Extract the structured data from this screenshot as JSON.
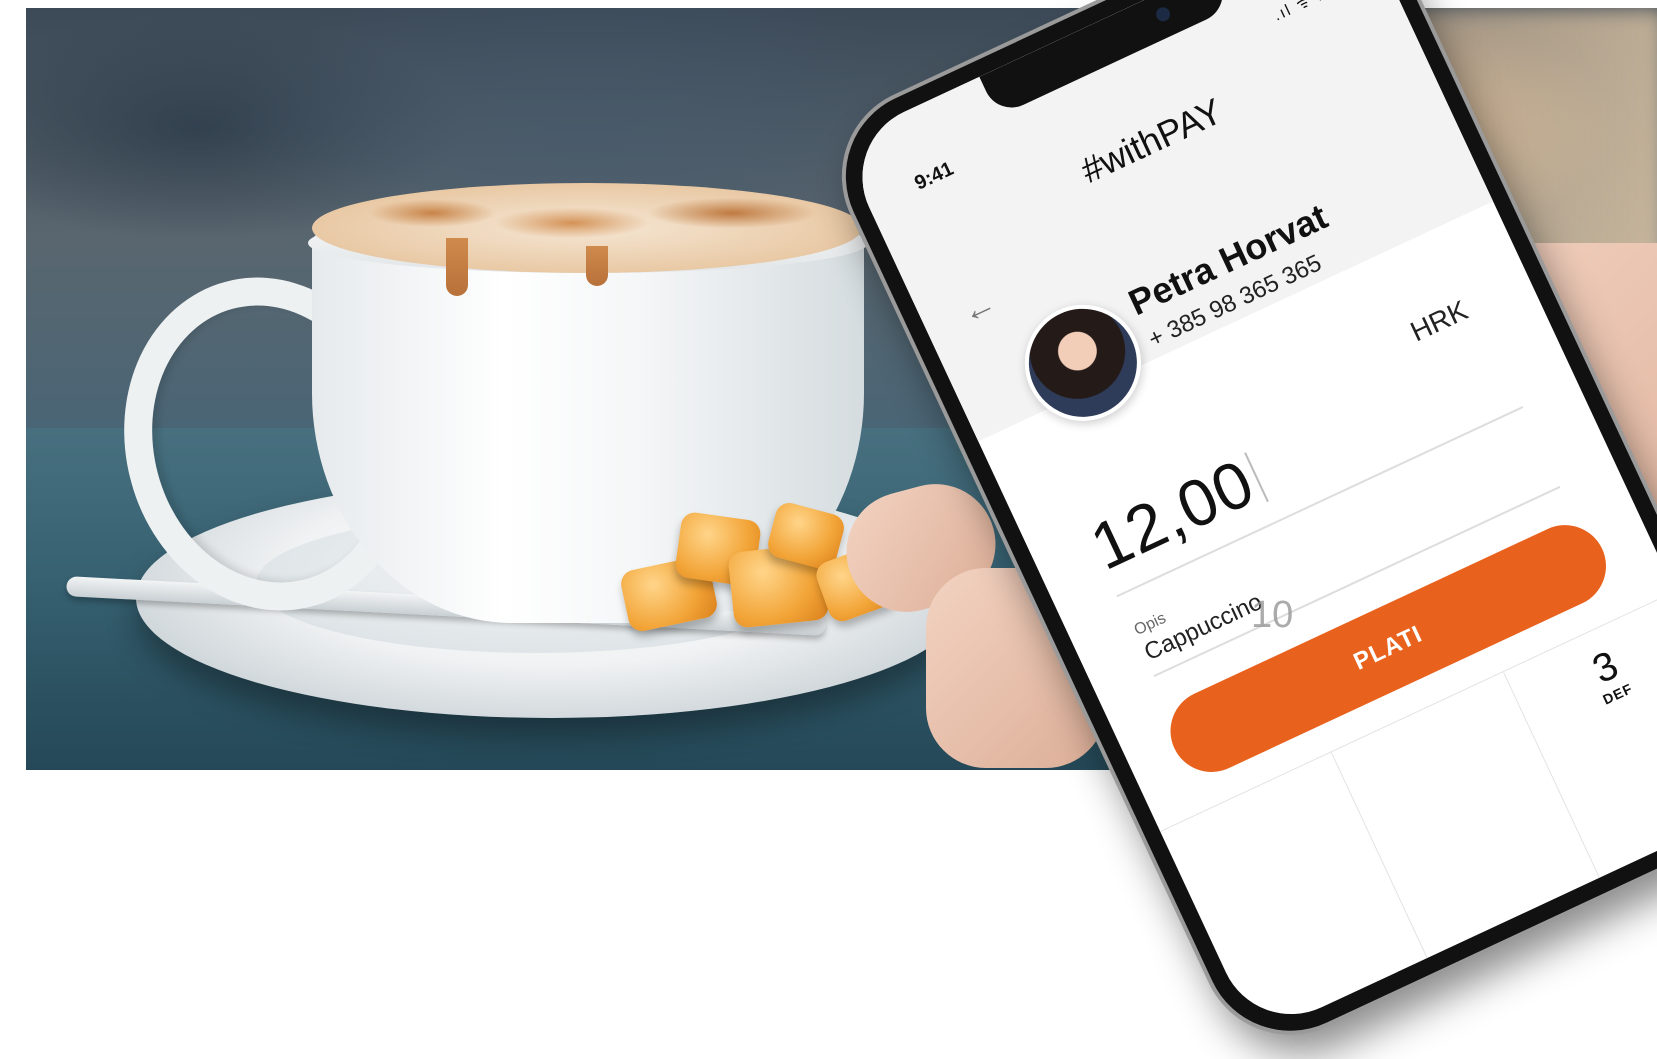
{
  "phone": {
    "time": "9:41",
    "status": ".ıl ᯤ ▬",
    "brand": "#withPAY",
    "back_icon": "arrow-left-icon",
    "contact": {
      "name": "Petra Horvat",
      "phone": "+ 385 98 365 365"
    },
    "currency": "HRK",
    "amount": "12,00",
    "description_label": "Opis",
    "description_value": "Cappuccino",
    "pay_button": "PLATI",
    "keypad": [
      {
        "num": "",
        "letters": ""
      },
      {
        "num": "",
        "letters": ""
      },
      {
        "num": "3",
        "letters": "DEF"
      }
    ],
    "accent": "#e8621d"
  },
  "overlay_number": "10"
}
